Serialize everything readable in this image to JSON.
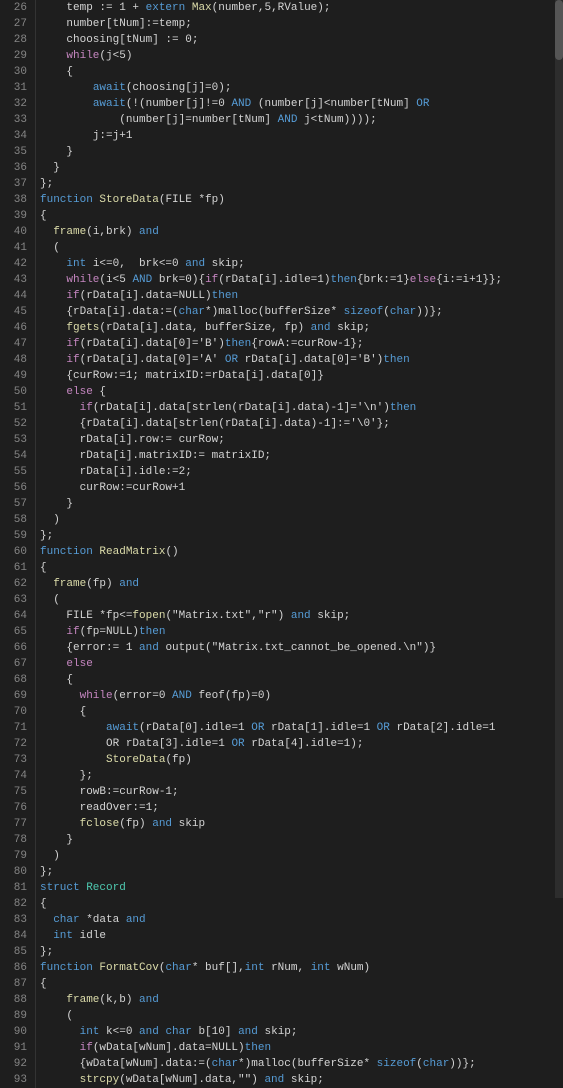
{
  "lines": [
    {
      "num": "26",
      "content": [
        {
          "t": "    temp := 1 + ",
          "c": "plain"
        },
        {
          "t": "extern",
          "c": "kw"
        },
        {
          "t": " ",
          "c": "plain"
        },
        {
          "t": "Max",
          "c": "fn"
        },
        {
          "t": "(number,5,RValue);",
          "c": "plain"
        }
      ]
    },
    {
      "num": "27",
      "content": [
        {
          "t": "    number[tNum]:=temp;",
          "c": "plain"
        }
      ]
    },
    {
      "num": "28",
      "content": [
        {
          "t": "    choosing[tNum] := 0;",
          "c": "plain"
        }
      ]
    },
    {
      "num": "29",
      "content": [
        {
          "t": "    ",
          "c": "plain"
        },
        {
          "t": "while",
          "c": "kw2"
        },
        {
          "t": "(j<5)",
          "c": "plain"
        }
      ]
    },
    {
      "num": "30",
      "content": [
        {
          "t": "    {",
          "c": "plain"
        }
      ]
    },
    {
      "num": "31",
      "content": [
        {
          "t": "        ",
          "c": "plain"
        },
        {
          "t": "await",
          "c": "kw"
        },
        {
          "t": "(choosing[j]=0);",
          "c": "plain"
        }
      ]
    },
    {
      "num": "32",
      "content": [
        {
          "t": "        ",
          "c": "plain"
        },
        {
          "t": "await",
          "c": "kw"
        },
        {
          "t": "(!(number[j]!=0 ",
          "c": "plain"
        },
        {
          "t": "AND",
          "c": "kw"
        },
        {
          "t": " (number[j]<number[tNum] ",
          "c": "plain"
        },
        {
          "t": "OR",
          "c": "kw"
        }
      ]
    },
    {
      "num": "33",
      "content": [
        {
          "t": "            (number[j]=number[tNum] ",
          "c": "plain"
        },
        {
          "t": "AND",
          "c": "kw"
        },
        {
          "t": " j<tNum))));",
          "c": "plain"
        }
      ]
    },
    {
      "num": "34",
      "content": [
        {
          "t": "        j:=j+1",
          "c": "plain"
        }
      ]
    },
    {
      "num": "35",
      "content": [
        {
          "t": "    }",
          "c": "plain"
        }
      ]
    },
    {
      "num": "36",
      "content": [
        {
          "t": "  }",
          "c": "plain"
        }
      ]
    },
    {
      "num": "37",
      "content": [
        {
          "t": "};",
          "c": "plain"
        }
      ]
    },
    {
      "num": "38",
      "content": [
        {
          "t": "function",
          "c": "kw"
        },
        {
          "t": " ",
          "c": "plain"
        },
        {
          "t": "StoreData",
          "c": "fn"
        },
        {
          "t": "(FILE *fp)",
          "c": "plain"
        }
      ]
    },
    {
      "num": "39",
      "content": [
        {
          "t": "{",
          "c": "plain"
        }
      ]
    },
    {
      "num": "40",
      "content": [
        {
          "t": "  ",
          "c": "plain"
        },
        {
          "t": "frame",
          "c": "fn"
        },
        {
          "t": "(i,brk) ",
          "c": "plain"
        },
        {
          "t": "and",
          "c": "kw"
        }
      ]
    },
    {
      "num": "41",
      "content": [
        {
          "t": "  (",
          "c": "plain"
        }
      ]
    },
    {
      "num": "42",
      "content": [
        {
          "t": "    ",
          "c": "plain"
        },
        {
          "t": "int",
          "c": "kw"
        },
        {
          "t": " i<=0,  brk<=0 ",
          "c": "plain"
        },
        {
          "t": "and",
          "c": "kw"
        },
        {
          "t": " skip;",
          "c": "plain"
        }
      ]
    },
    {
      "num": "43",
      "content": [
        {
          "t": "    ",
          "c": "plain"
        },
        {
          "t": "while",
          "c": "kw2"
        },
        {
          "t": "(i<5 ",
          "c": "plain"
        },
        {
          "t": "AND",
          "c": "kw"
        },
        {
          "t": " brk=0){",
          "c": "plain"
        },
        {
          "t": "if",
          "c": "kw2"
        },
        {
          "t": "(rData[i].idle=1)",
          "c": "plain"
        },
        {
          "t": "then",
          "c": "kw"
        },
        {
          "t": "{brk:=1}",
          "c": "plain"
        },
        {
          "t": "else",
          "c": "kw2"
        },
        {
          "t": "{i:=i+1}};",
          "c": "plain"
        }
      ]
    },
    {
      "num": "44",
      "content": [
        {
          "t": "    ",
          "c": "plain"
        },
        {
          "t": "if",
          "c": "kw2"
        },
        {
          "t": "(rData[i].data=NULL)",
          "c": "plain"
        },
        {
          "t": "then",
          "c": "kw"
        }
      ]
    },
    {
      "num": "45",
      "content": [
        {
          "t": "    {rData[i].data:=(",
          "c": "plain"
        },
        {
          "t": "char",
          "c": "kw"
        },
        {
          "t": "*)malloc(bufferSize* ",
          "c": "plain"
        },
        {
          "t": "sizeof",
          "c": "kw"
        },
        {
          "t": "(",
          "c": "plain"
        },
        {
          "t": "char",
          "c": "kw"
        },
        {
          "t": "))};",
          "c": "plain"
        }
      ]
    },
    {
      "num": "46",
      "content": [
        {
          "t": "    ",
          "c": "plain"
        },
        {
          "t": "fgets",
          "c": "fn"
        },
        {
          "t": "(rData[i].data, bufferSize, fp) ",
          "c": "plain"
        },
        {
          "t": "and",
          "c": "kw"
        },
        {
          "t": " skip;",
          "c": "plain"
        }
      ]
    },
    {
      "num": "47",
      "content": [
        {
          "t": "    ",
          "c": "plain"
        },
        {
          "t": "if",
          "c": "kw2"
        },
        {
          "t": "(rData[i].data[0]='B')",
          "c": "plain"
        },
        {
          "t": "then",
          "c": "kw"
        },
        {
          "t": "{rowA:=curRow-1};",
          "c": "plain"
        }
      ]
    },
    {
      "num": "48",
      "content": [
        {
          "t": "    ",
          "c": "plain"
        },
        {
          "t": "if",
          "c": "kw2"
        },
        {
          "t": "(rData[i].data[0]='A' ",
          "c": "plain"
        },
        {
          "t": "OR",
          "c": "kw"
        },
        {
          "t": " rData[i].data[0]='B')",
          "c": "plain"
        },
        {
          "t": "then",
          "c": "kw"
        }
      ]
    },
    {
      "num": "49",
      "content": [
        {
          "t": "    {curRow:=1; matrixID:=rData[i].data[0]}",
          "c": "plain"
        }
      ]
    },
    {
      "num": "50",
      "content": [
        {
          "t": "    ",
          "c": "plain"
        },
        {
          "t": "else",
          "c": "kw2"
        },
        {
          "t": " {",
          "c": "plain"
        }
      ]
    },
    {
      "num": "51",
      "content": [
        {
          "t": "      ",
          "c": "plain"
        },
        {
          "t": "if",
          "c": "kw2"
        },
        {
          "t": "(rData[i].data[strlen(rData[i].data)-1]='\\n')",
          "c": "plain"
        },
        {
          "t": "then",
          "c": "kw"
        }
      ]
    },
    {
      "num": "52",
      "content": [
        {
          "t": "      {rData[i].data[strlen(rData[i].data)-1]:='\\0'};",
          "c": "plain"
        }
      ]
    },
    {
      "num": "53",
      "content": [
        {
          "t": "      rData[i].row:= curRow;",
          "c": "plain"
        }
      ]
    },
    {
      "num": "54",
      "content": [
        {
          "t": "      rData[i].matrixID:= matrixID;",
          "c": "plain"
        }
      ]
    },
    {
      "num": "55",
      "content": [
        {
          "t": "      rData[i].idle:=2;",
          "c": "plain"
        }
      ]
    },
    {
      "num": "56",
      "content": [
        {
          "t": "      curRow:=curRow+1",
          "c": "plain"
        }
      ]
    },
    {
      "num": "57",
      "content": [
        {
          "t": "    }",
          "c": "plain"
        }
      ]
    },
    {
      "num": "58",
      "content": [
        {
          "t": "  )",
          "c": "plain"
        }
      ]
    },
    {
      "num": "59",
      "content": [
        {
          "t": "};",
          "c": "plain"
        }
      ]
    },
    {
      "num": "60",
      "content": [
        {
          "t": "function",
          "c": "kw"
        },
        {
          "t": " ",
          "c": "plain"
        },
        {
          "t": "ReadMatrix",
          "c": "fn"
        },
        {
          "t": "()",
          "c": "plain"
        }
      ]
    },
    {
      "num": "61",
      "content": [
        {
          "t": "{",
          "c": "plain"
        }
      ]
    },
    {
      "num": "62",
      "content": [
        {
          "t": "  ",
          "c": "plain"
        },
        {
          "t": "frame",
          "c": "fn"
        },
        {
          "t": "(fp) ",
          "c": "plain"
        },
        {
          "t": "and",
          "c": "kw"
        }
      ]
    },
    {
      "num": "63",
      "content": [
        {
          "t": "  (",
          "c": "plain"
        }
      ]
    },
    {
      "num": "64",
      "content": [
        {
          "t": "    FILE *fp<=",
          "c": "plain"
        },
        {
          "t": "fopen",
          "c": "fn"
        },
        {
          "t": "(\"Matrix.txt\",\"r\") ",
          "c": "plain"
        },
        {
          "t": "and",
          "c": "kw"
        },
        {
          "t": " skip;",
          "c": "plain"
        }
      ]
    },
    {
      "num": "65",
      "content": [
        {
          "t": "    ",
          "c": "plain"
        },
        {
          "t": "if",
          "c": "kw2"
        },
        {
          "t": "(fp=NULL)",
          "c": "plain"
        },
        {
          "t": "then",
          "c": "kw"
        }
      ]
    },
    {
      "num": "66",
      "content": [
        {
          "t": "    {error:= 1 ",
          "c": "plain"
        },
        {
          "t": "and",
          "c": "kw"
        },
        {
          "t": " output(\"Matrix.txt_cannot_be_opened.\\n\")}",
          "c": "plain"
        }
      ]
    },
    {
      "num": "67",
      "content": [
        {
          "t": "    ",
          "c": "plain"
        },
        {
          "t": "else",
          "c": "kw2"
        }
      ]
    },
    {
      "num": "68",
      "content": [
        {
          "t": "    {",
          "c": "plain"
        }
      ]
    },
    {
      "num": "69",
      "content": [
        {
          "t": "      ",
          "c": "plain"
        },
        {
          "t": "while",
          "c": "kw2"
        },
        {
          "t": "(error=0 ",
          "c": "plain"
        },
        {
          "t": "AND",
          "c": "kw"
        },
        {
          "t": " feof(fp)=0)",
          "c": "plain"
        }
      ]
    },
    {
      "num": "70",
      "content": [
        {
          "t": "      {",
          "c": "plain"
        }
      ]
    },
    {
      "num": "71",
      "content": [
        {
          "t": "          ",
          "c": "plain"
        },
        {
          "t": "await",
          "c": "kw"
        },
        {
          "t": "(rData[0].idle=1 ",
          "c": "plain"
        },
        {
          "t": "OR",
          "c": "kw"
        },
        {
          "t": " rData[1].idle=1 ",
          "c": "plain"
        },
        {
          "t": "OR",
          "c": "kw"
        },
        {
          "t": " rData[2].idle=1",
          "c": "plain"
        }
      ]
    },
    {
      "num": "72",
      "content": [
        {
          "t": "          OR rData[3].idle=1 ",
          "c": "plain"
        },
        {
          "t": "OR",
          "c": "kw"
        },
        {
          "t": " rData[4].idle=1);",
          "c": "plain"
        }
      ]
    },
    {
      "num": "73",
      "content": [
        {
          "t": "          ",
          "c": "plain"
        },
        {
          "t": "StoreData",
          "c": "fn"
        },
        {
          "t": "(fp)",
          "c": "plain"
        }
      ]
    },
    {
      "num": "74",
      "content": [
        {
          "t": "      };",
          "c": "plain"
        }
      ]
    },
    {
      "num": "75",
      "content": [
        {
          "t": "      rowB:=curRow-1;",
          "c": "plain"
        }
      ]
    },
    {
      "num": "76",
      "content": [
        {
          "t": "      readOver:=1;",
          "c": "plain"
        }
      ]
    },
    {
      "num": "77",
      "content": [
        {
          "t": "      ",
          "c": "plain"
        },
        {
          "t": "fclose",
          "c": "fn"
        },
        {
          "t": "(fp) ",
          "c": "plain"
        },
        {
          "t": "and",
          "c": "kw"
        },
        {
          "t": " skip",
          "c": "plain"
        }
      ]
    },
    {
      "num": "78",
      "content": [
        {
          "t": "    }",
          "c": "plain"
        }
      ]
    },
    {
      "num": "79",
      "content": [
        {
          "t": "  )",
          "c": "plain"
        }
      ]
    },
    {
      "num": "80",
      "content": [
        {
          "t": "};",
          "c": "plain"
        }
      ]
    },
    {
      "num": "81",
      "content": [
        {
          "t": "struct",
          "c": "kw"
        },
        {
          "t": " Record",
          "c": "type"
        }
      ]
    },
    {
      "num": "82",
      "content": [
        {
          "t": "{",
          "c": "plain"
        }
      ]
    },
    {
      "num": "83",
      "content": [
        {
          "t": "  ",
          "c": "plain"
        },
        {
          "t": "char",
          "c": "kw"
        },
        {
          "t": " *data ",
          "c": "plain"
        },
        {
          "t": "and",
          "c": "kw"
        }
      ]
    },
    {
      "num": "84",
      "content": [
        {
          "t": "  ",
          "c": "plain"
        },
        {
          "t": "int",
          "c": "kw"
        },
        {
          "t": " idle",
          "c": "plain"
        }
      ]
    },
    {
      "num": "85",
      "content": [
        {
          "t": "};",
          "c": "plain"
        }
      ]
    },
    {
      "num": "86",
      "content": [
        {
          "t": "function",
          "c": "kw"
        },
        {
          "t": " ",
          "c": "plain"
        },
        {
          "t": "FormatCov",
          "c": "fn"
        },
        {
          "t": "(",
          "c": "plain"
        },
        {
          "t": "char",
          "c": "kw"
        },
        {
          "t": "* buf[],",
          "c": "plain"
        },
        {
          "t": "int",
          "c": "kw"
        },
        {
          "t": " rNum, ",
          "c": "plain"
        },
        {
          "t": "int",
          "c": "kw"
        },
        {
          "t": " wNum)",
          "c": "plain"
        }
      ]
    },
    {
      "num": "87",
      "content": [
        {
          "t": "{",
          "c": "plain"
        }
      ]
    },
    {
      "num": "88",
      "content": [
        {
          "t": "    ",
          "c": "plain"
        },
        {
          "t": "frame",
          "c": "fn"
        },
        {
          "t": "(k,b) ",
          "c": "plain"
        },
        {
          "t": "and",
          "c": "kw"
        }
      ]
    },
    {
      "num": "89",
      "content": [
        {
          "t": "    (",
          "c": "plain"
        }
      ]
    },
    {
      "num": "90",
      "content": [
        {
          "t": "      ",
          "c": "plain"
        },
        {
          "t": "int",
          "c": "kw"
        },
        {
          "t": " k<=0 ",
          "c": "plain"
        },
        {
          "t": "and",
          "c": "kw"
        },
        {
          "t": " ",
          "c": "plain"
        },
        {
          "t": "char",
          "c": "kw"
        },
        {
          "t": " b[10] ",
          "c": "plain"
        },
        {
          "t": "and",
          "c": "kw"
        },
        {
          "t": " skip;",
          "c": "plain"
        }
      ]
    },
    {
      "num": "91",
      "content": [
        {
          "t": "      ",
          "c": "plain"
        },
        {
          "t": "if",
          "c": "kw2"
        },
        {
          "t": "(wData[wNum].data=NULL)",
          "c": "plain"
        },
        {
          "t": "then",
          "c": "kw"
        }
      ]
    },
    {
      "num": "92",
      "content": [
        {
          "t": "      {wData[wNum].data:=(",
          "c": "plain"
        },
        {
          "t": "char",
          "c": "kw"
        },
        {
          "t": "*)malloc(bufferSize* ",
          "c": "plain"
        },
        {
          "t": "sizeof",
          "c": "kw"
        },
        {
          "t": "(",
          "c": "plain"
        },
        {
          "t": "char",
          "c": "kw"
        },
        {
          "t": "))};",
          "c": "plain"
        }
      ]
    },
    {
      "num": "93",
      "content": [
        {
          "t": "      ",
          "c": "plain"
        },
        {
          "t": "strcpy",
          "c": "fn"
        },
        {
          "t": "(wData[wNum].data,\"\") ",
          "c": "plain"
        },
        {
          "t": "and",
          "c": "kw"
        },
        {
          "t": " skip;",
          "c": "plain"
        }
      ]
    }
  ]
}
